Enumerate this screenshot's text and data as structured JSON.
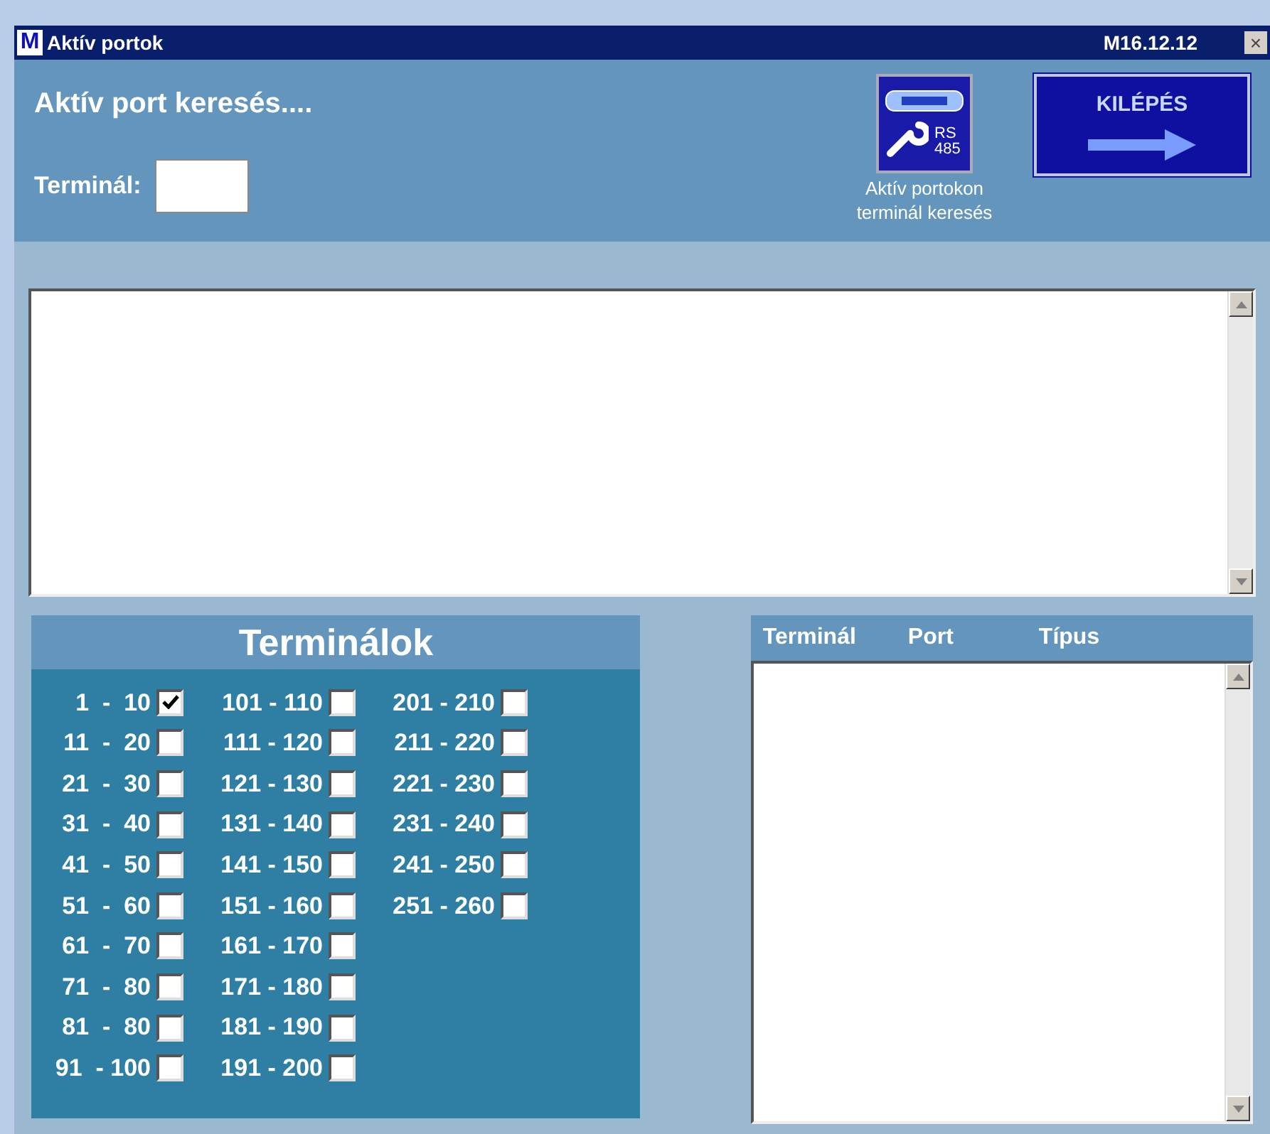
{
  "window": {
    "logo": "M",
    "title": "Aktív portok",
    "version": "M16.12.12",
    "close": "×"
  },
  "header": {
    "heading": "Aktív port keresés....",
    "terminal_label": "Terminál:",
    "search_button": {
      "caption": "Aktív portokon terminál keresés",
      "icon_text": "RS 485"
    },
    "exit_button": {
      "label": "KILÉPÉS"
    }
  },
  "terminals": {
    "title": "Terminálok",
    "columns": [
      [
        {
          "label": "1  -  10",
          "checked": true
        },
        {
          "label": "11  -  20",
          "checked": false
        },
        {
          "label": "21  -  30",
          "checked": false
        },
        {
          "label": "31  -  40",
          "checked": false
        },
        {
          "label": "41  -  50",
          "checked": false
        },
        {
          "label": "51  -  60",
          "checked": false
        },
        {
          "label": "61  -  70",
          "checked": false
        },
        {
          "label": "71  -  80",
          "checked": false
        },
        {
          "label": "81  -  80",
          "checked": false
        },
        {
          "label": "91  - 100",
          "checked": false
        }
      ],
      [
        {
          "label": "101 - 110",
          "checked": false
        },
        {
          "label": "111 - 120",
          "checked": false
        },
        {
          "label": "121 - 130",
          "checked": false
        },
        {
          "label": "131 - 140",
          "checked": false
        },
        {
          "label": "141 - 150",
          "checked": false
        },
        {
          "label": "151 - 160",
          "checked": false
        },
        {
          "label": "161 - 170",
          "checked": false
        },
        {
          "label": "171 - 180",
          "checked": false
        },
        {
          "label": "181 - 190",
          "checked": false
        },
        {
          "label": "191 - 200",
          "checked": false
        }
      ],
      [
        {
          "label": "201 - 210",
          "checked": false
        },
        {
          "label": "211 - 220",
          "checked": false
        },
        {
          "label": "221 - 230",
          "checked": false
        },
        {
          "label": "231 - 240",
          "checked": false
        },
        {
          "label": "241 - 250",
          "checked": false
        },
        {
          "label": "251 - 260",
          "checked": false
        }
      ]
    ]
  },
  "results": {
    "columns": [
      "Terminál",
      "Port",
      "Típus"
    ]
  }
}
